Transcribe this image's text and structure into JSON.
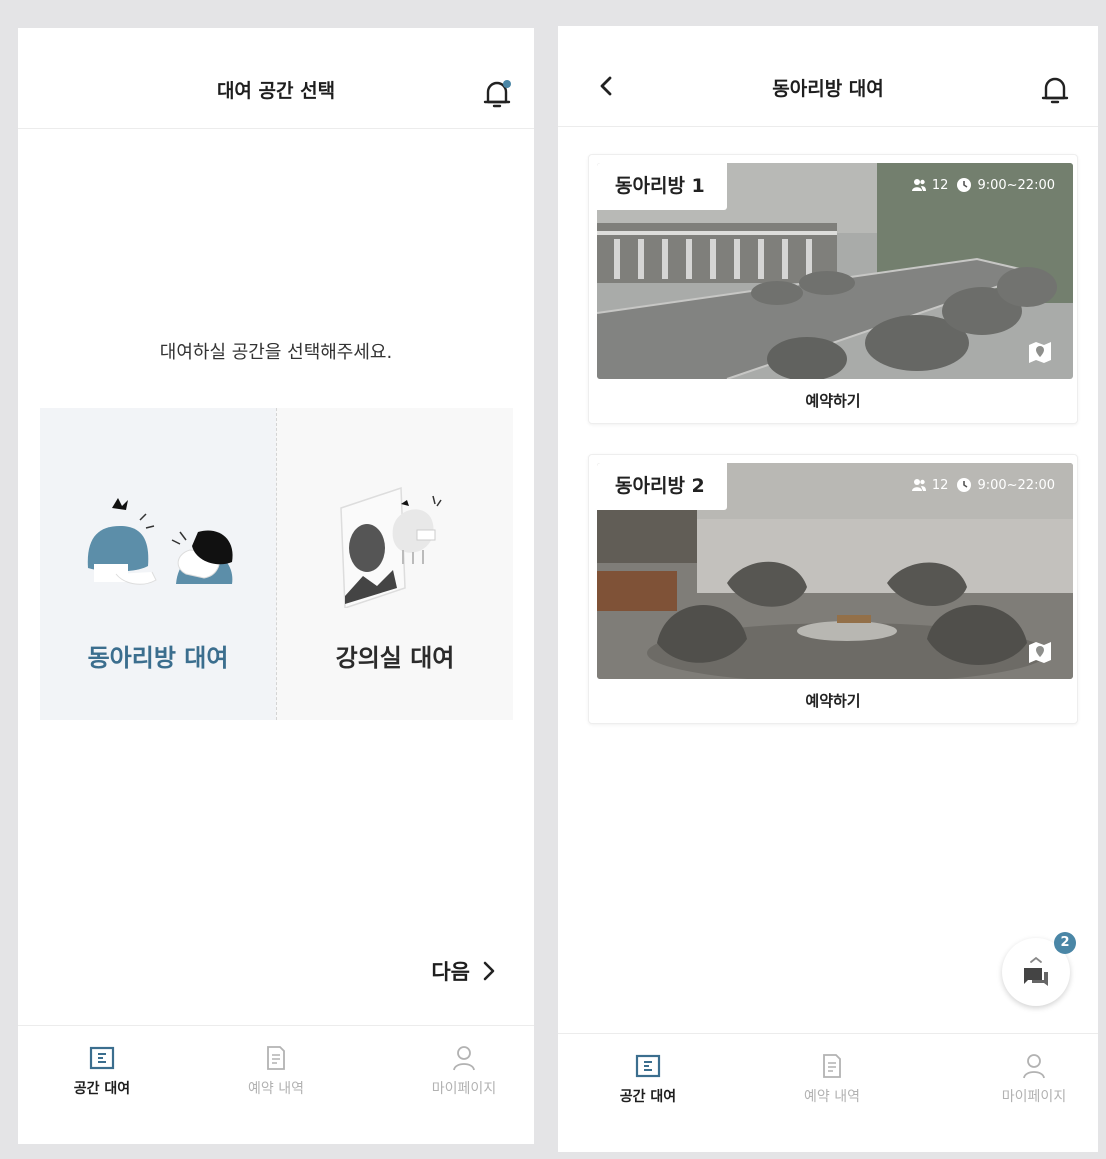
{
  "left_screen": {
    "header": {
      "title": "대여 공간 선택",
      "bell_icon": "notification-bell-icon-with-dot"
    },
    "prompt": "대여하실 공간을 선택해주세요.",
    "choices": [
      {
        "label": "동아리방 대여",
        "selected": true,
        "icon": "people-talking-illustration"
      },
      {
        "label": "강의실 대여",
        "selected": false,
        "icon": "lecture-board-illustration"
      }
    ],
    "next_label": "다음"
  },
  "right_screen": {
    "header": {
      "title": "동아리방 대여",
      "back_icon": "chevron-left-icon",
      "bell_icon": "notification-bell-icon"
    },
    "rooms": [
      {
        "name": "동아리방 1",
        "capacity": "12",
        "hours": "9:00~22:00",
        "action": "예약하기"
      },
      {
        "name": "동아리방 2",
        "capacity": "12",
        "hours": "9:00~22:00",
        "action": "예약하기"
      }
    ],
    "chat_badge": "2"
  },
  "tabbar": {
    "items": [
      {
        "label": "공간 대여",
        "active": true,
        "icon": "space-rent-icon"
      },
      {
        "label": "예약 내역",
        "active": false,
        "icon": "document-icon"
      },
      {
        "label": "마이페이지",
        "active": false,
        "icon": "person-icon"
      }
    ]
  },
  "colors": {
    "accent": "#3b6e8e",
    "badge": "#4a86a6",
    "inactive": "#b2b2b2"
  }
}
